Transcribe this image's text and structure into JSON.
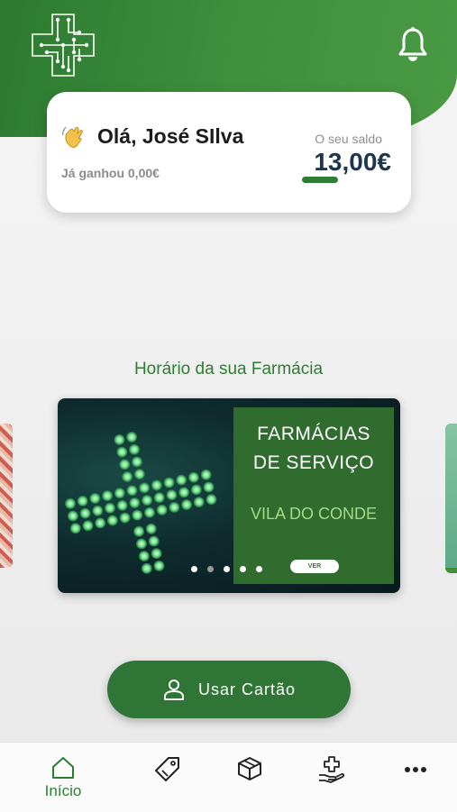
{
  "header": {
    "logo_icon": "pharmacy-cross-logo-icon",
    "notifications_icon": "bell-icon"
  },
  "greeting": {
    "emoji_icon": "waving-hand-icon",
    "text": "Olá, José SIlva",
    "earned_text": "Já ganhou 0,00€"
  },
  "balance": {
    "label": "O seu saldo",
    "value": "13,00€",
    "accent_color": "#2e7d32"
  },
  "section": {
    "title": "Horário da sua Farmácia"
  },
  "carousel": {
    "banner_title_line1": "FARMÁCIAS",
    "banner_title_line2": "DE SERVIÇO",
    "banner_city": "VILA DO CONDE",
    "banner_button": "VER",
    "active_slide": 1,
    "slide_count": 5
  },
  "cta": {
    "label": "Usar Cartão",
    "icon": "user-icon"
  },
  "nav": {
    "items": [
      {
        "label": "Início",
        "icon": "home-icon",
        "active": true
      },
      {
        "label": "",
        "icon": "tag-icon",
        "active": false
      },
      {
        "label": "",
        "icon": "box-icon",
        "active": false
      },
      {
        "label": "",
        "icon": "hand-cross-icon",
        "active": false
      },
      {
        "label": "",
        "icon": "more-icon",
        "active": false
      }
    ]
  },
  "colors": {
    "brand_green": "#2e7d32",
    "balance_text": "#1e3550"
  }
}
